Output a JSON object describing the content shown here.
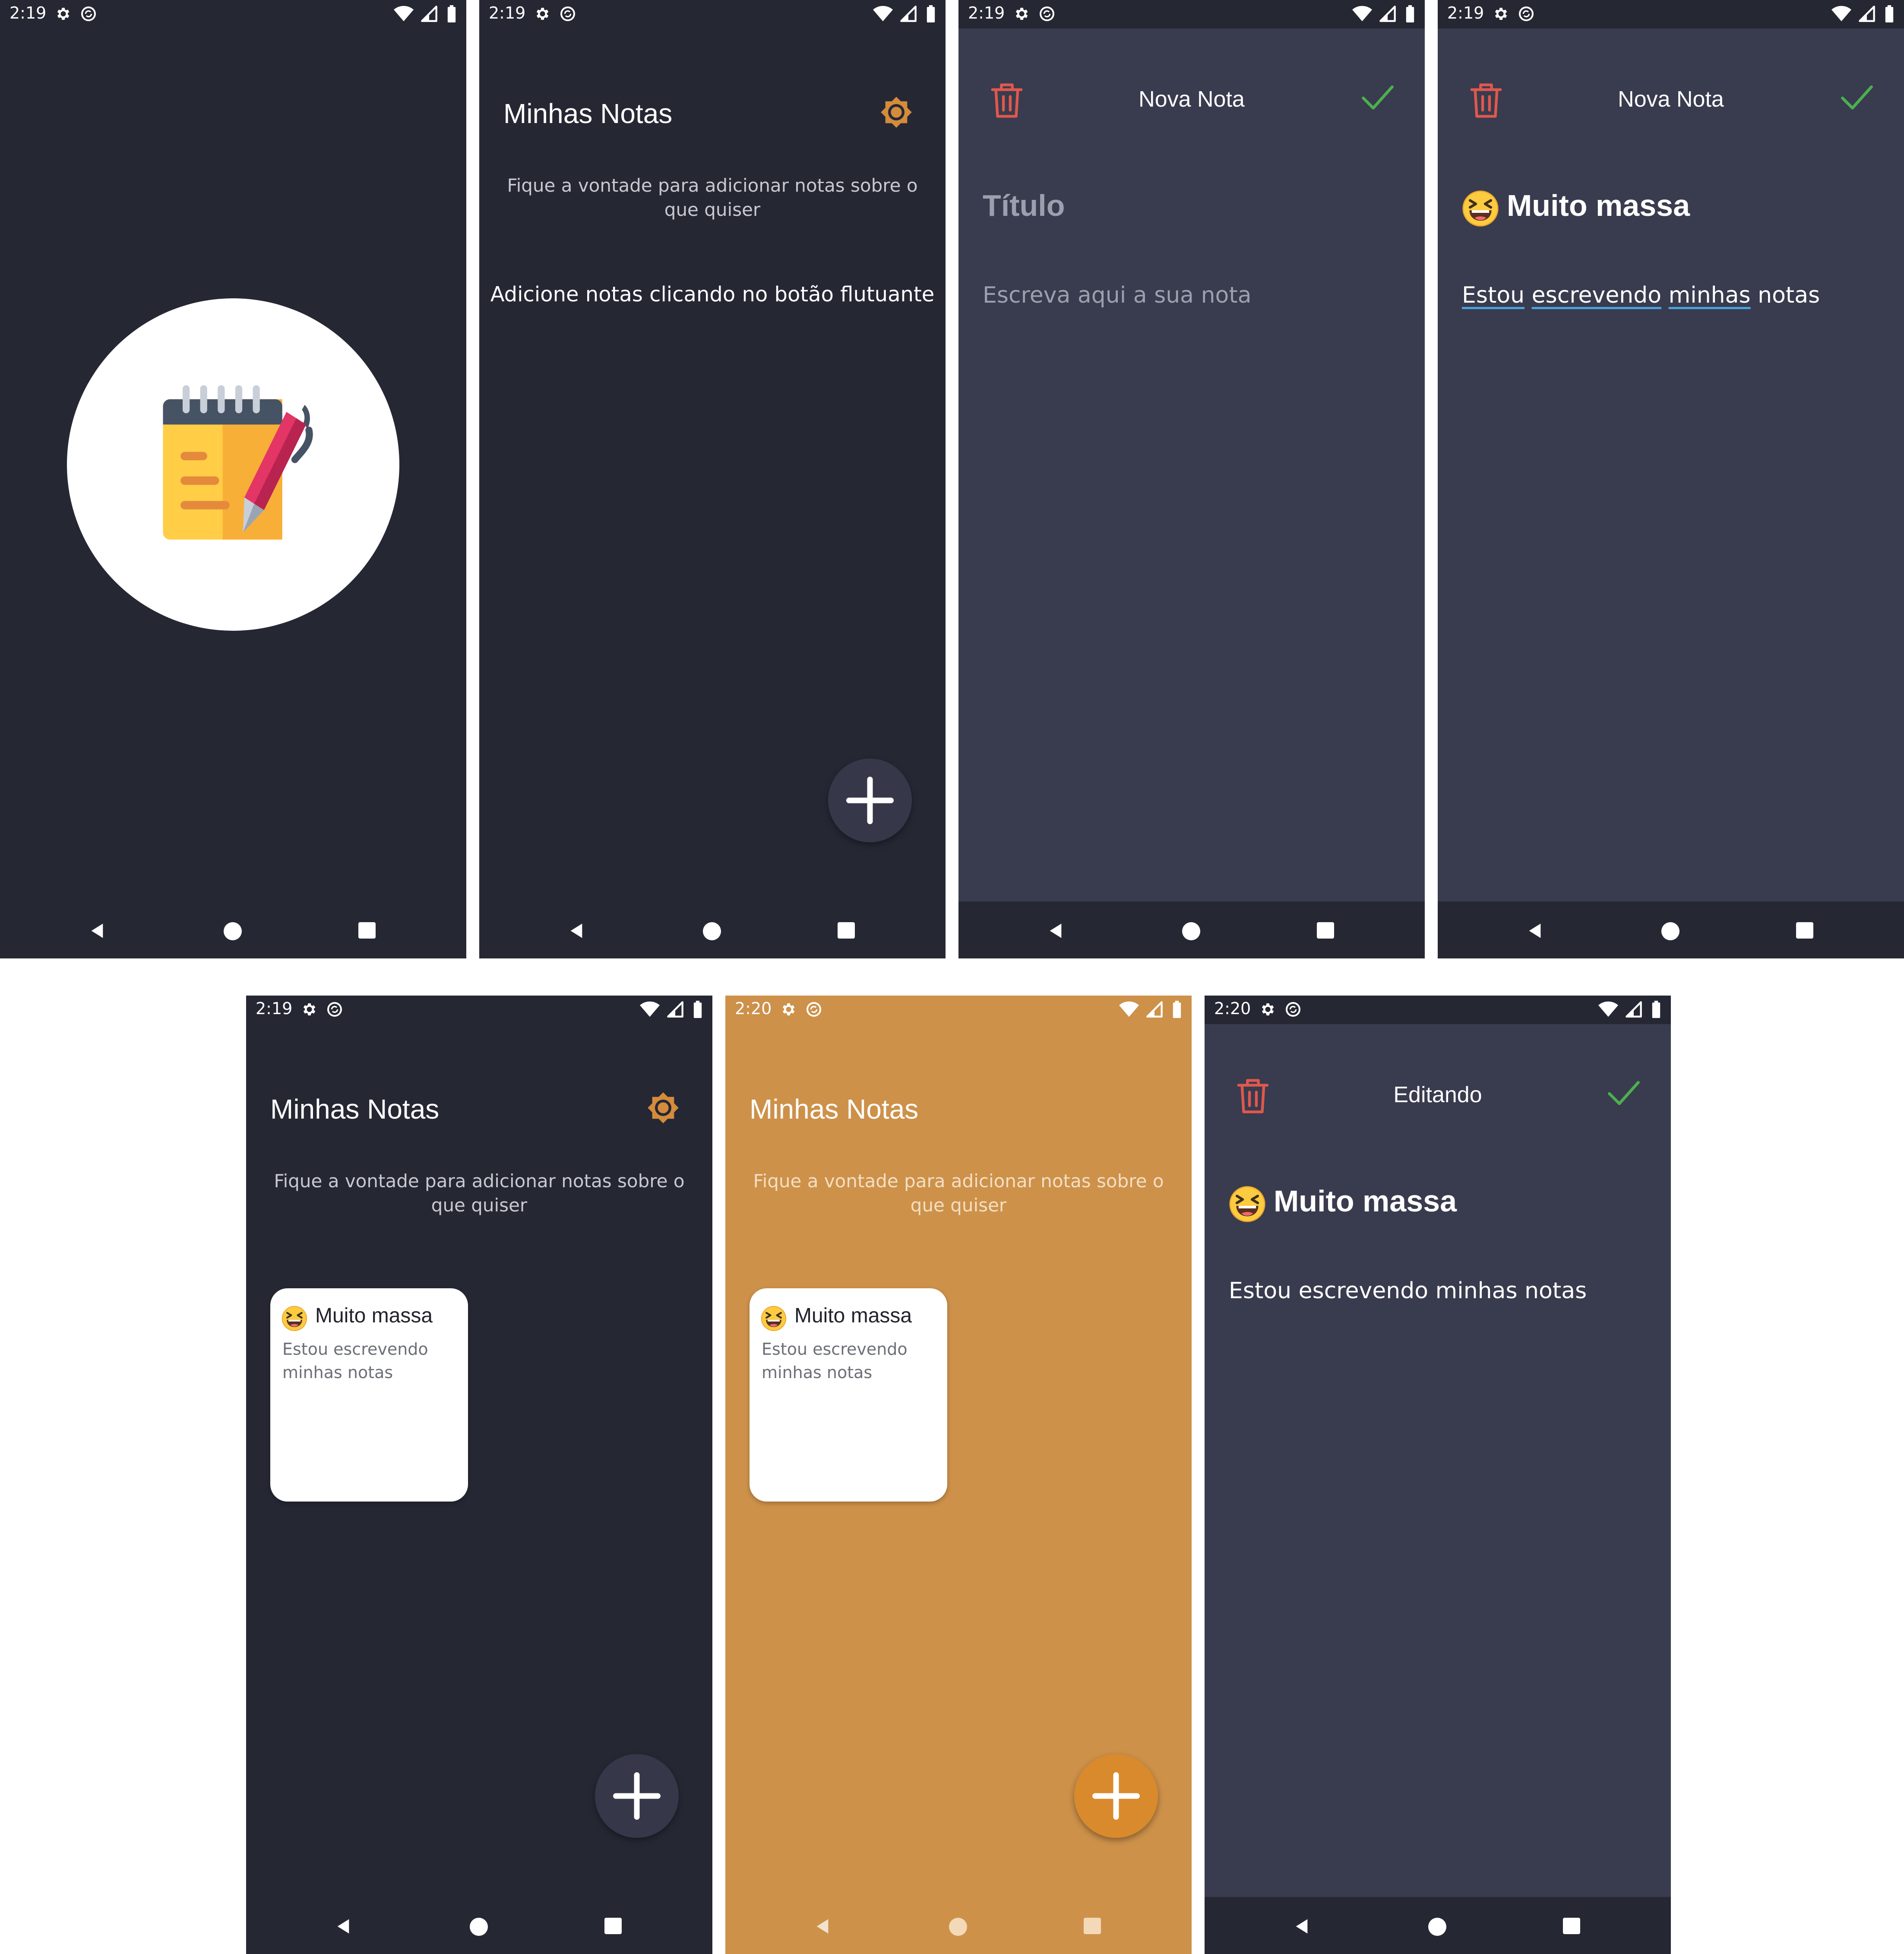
{
  "status_bar": {
    "times": [
      "2:19",
      "2:19",
      "2:19",
      "2:19",
      "2:19",
      "2:20",
      "2:20"
    ]
  },
  "home": {
    "title": "Minhas Notas",
    "subtitle": "Fique a vontade para adicionar notas sobre o que quiser",
    "empty_message": "Adicione notas clicando no botão flutuante",
    "fab_icon": "plus-icon",
    "theme_toggle_icon_dark_mode": "sun-icon",
    "theme_toggle_icon_light_mode": "moon-icon"
  },
  "note_card": {
    "emoji": "laughing-face-emoji",
    "title": "Muito massa",
    "body": "Estou escrevendo minhas notas"
  },
  "new_note_editor": {
    "header_title": "Nova Nota",
    "title_placeholder": "Título",
    "body_placeholder": "Escreva aqui a sua nota",
    "typed_title": "Muito massa",
    "typed_body_words": [
      "Estou",
      "escrevendo",
      "minhas",
      "notas"
    ]
  },
  "edit_editor": {
    "header_title": "Editando",
    "title": "Muito massa",
    "body": "Estou escrevendo minhas notas"
  },
  "colors": {
    "dark_background": "#252733",
    "editor_background": "#393b4e",
    "light_mode_background": "#cd914a",
    "fab_light_mode": "#d98a2c",
    "fab_dark_mode": "#363849",
    "accent_orange": "#d38b3c",
    "delete_red": "#e0584e",
    "confirm_green": "#4caf50"
  }
}
